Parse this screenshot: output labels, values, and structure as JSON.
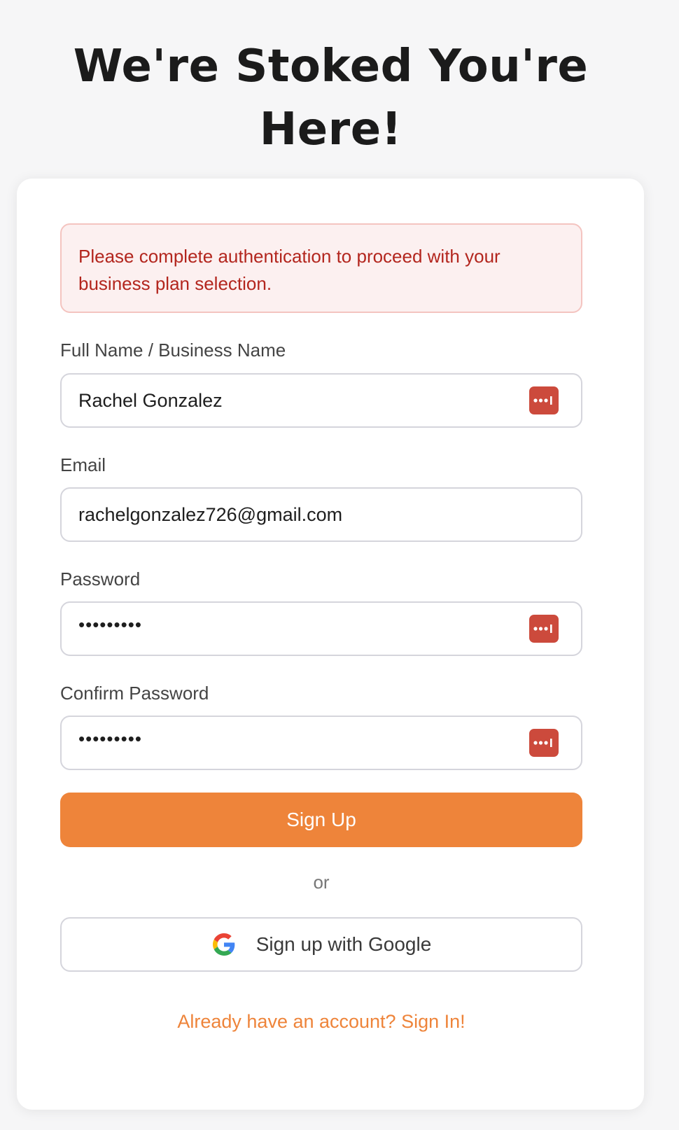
{
  "page": {
    "title": "We're Stoked You're Here!"
  },
  "alert": {
    "message": "Please complete authentication to proceed with your business plan selection."
  },
  "form": {
    "full_name": {
      "label": "Full Name / Business Name",
      "value": "Rachel Gonzalez"
    },
    "email": {
      "label": "Email",
      "value": "rachelgonzalez726@gmail.com"
    },
    "password": {
      "label": "Password",
      "value": "•••••••••"
    },
    "confirm_password": {
      "label": "Confirm Password",
      "value": "•••••••••"
    }
  },
  "actions": {
    "sign_up_label": "Sign Up",
    "divider": "or",
    "google_label": "Sign up with Google",
    "sign_in_link": "Already have an account? Sign In!"
  },
  "icons": {
    "password_manager": "password-manager-icon",
    "google": "google-icon"
  },
  "colors": {
    "accent": "#ee843a",
    "alert_text": "#b3261e",
    "alert_bg": "#fcf0f0",
    "password_manager": "#cc4a3c"
  }
}
